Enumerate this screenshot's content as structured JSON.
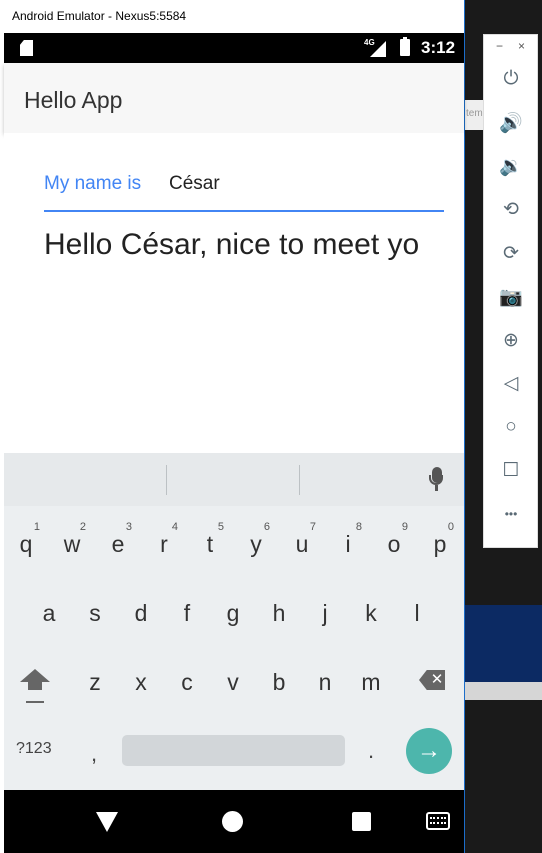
{
  "window": {
    "title": "Android Emulator - Nexus5:5584"
  },
  "status": {
    "network": "4G",
    "time": "3:12"
  },
  "app": {
    "title": "Hello App"
  },
  "form": {
    "label": "My name is",
    "value": "César",
    "greeting": "Hello César, nice to meet yo"
  },
  "keyboard": {
    "row1": [
      {
        "ch": "q",
        "num": "1"
      },
      {
        "ch": "w",
        "num": "2"
      },
      {
        "ch": "e",
        "num": "3"
      },
      {
        "ch": "r",
        "num": "4"
      },
      {
        "ch": "t",
        "num": "5"
      },
      {
        "ch": "y",
        "num": "6"
      },
      {
        "ch": "u",
        "num": "7"
      },
      {
        "ch": "i",
        "num": "8"
      },
      {
        "ch": "o",
        "num": "9"
      },
      {
        "ch": "p",
        "num": "0"
      }
    ],
    "row2": [
      "a",
      "s",
      "d",
      "f",
      "g",
      "h",
      "j",
      "k",
      "l"
    ],
    "row3": [
      "z",
      "x",
      "c",
      "v",
      "b",
      "n",
      "m"
    ],
    "symbols_label": "?123",
    "comma": ",",
    "period": ".",
    "enter_glyph": "→",
    "backspace_glyph": "✕"
  },
  "toolbar": {
    "minimize": "−",
    "close": "×",
    "items": [
      {
        "name": "power-icon",
        "glyph": "⏻"
      },
      {
        "name": "volume-up-icon",
        "glyph": "🔊"
      },
      {
        "name": "volume-down-icon",
        "glyph": "🔉"
      },
      {
        "name": "rotate-left-icon",
        "glyph": "⟲"
      },
      {
        "name": "rotate-right-icon",
        "glyph": "⟳"
      },
      {
        "name": "camera-icon",
        "glyph": "📷"
      },
      {
        "name": "zoom-icon",
        "glyph": "⊕"
      },
      {
        "name": "back-icon",
        "glyph": "◁"
      },
      {
        "name": "home-icon",
        "glyph": "○"
      },
      {
        "name": "overview-icon",
        "glyph": "☐"
      },
      {
        "name": "more-icon",
        "glyph": "•••"
      }
    ]
  },
  "backdrop": {
    "fragment": "tem"
  }
}
